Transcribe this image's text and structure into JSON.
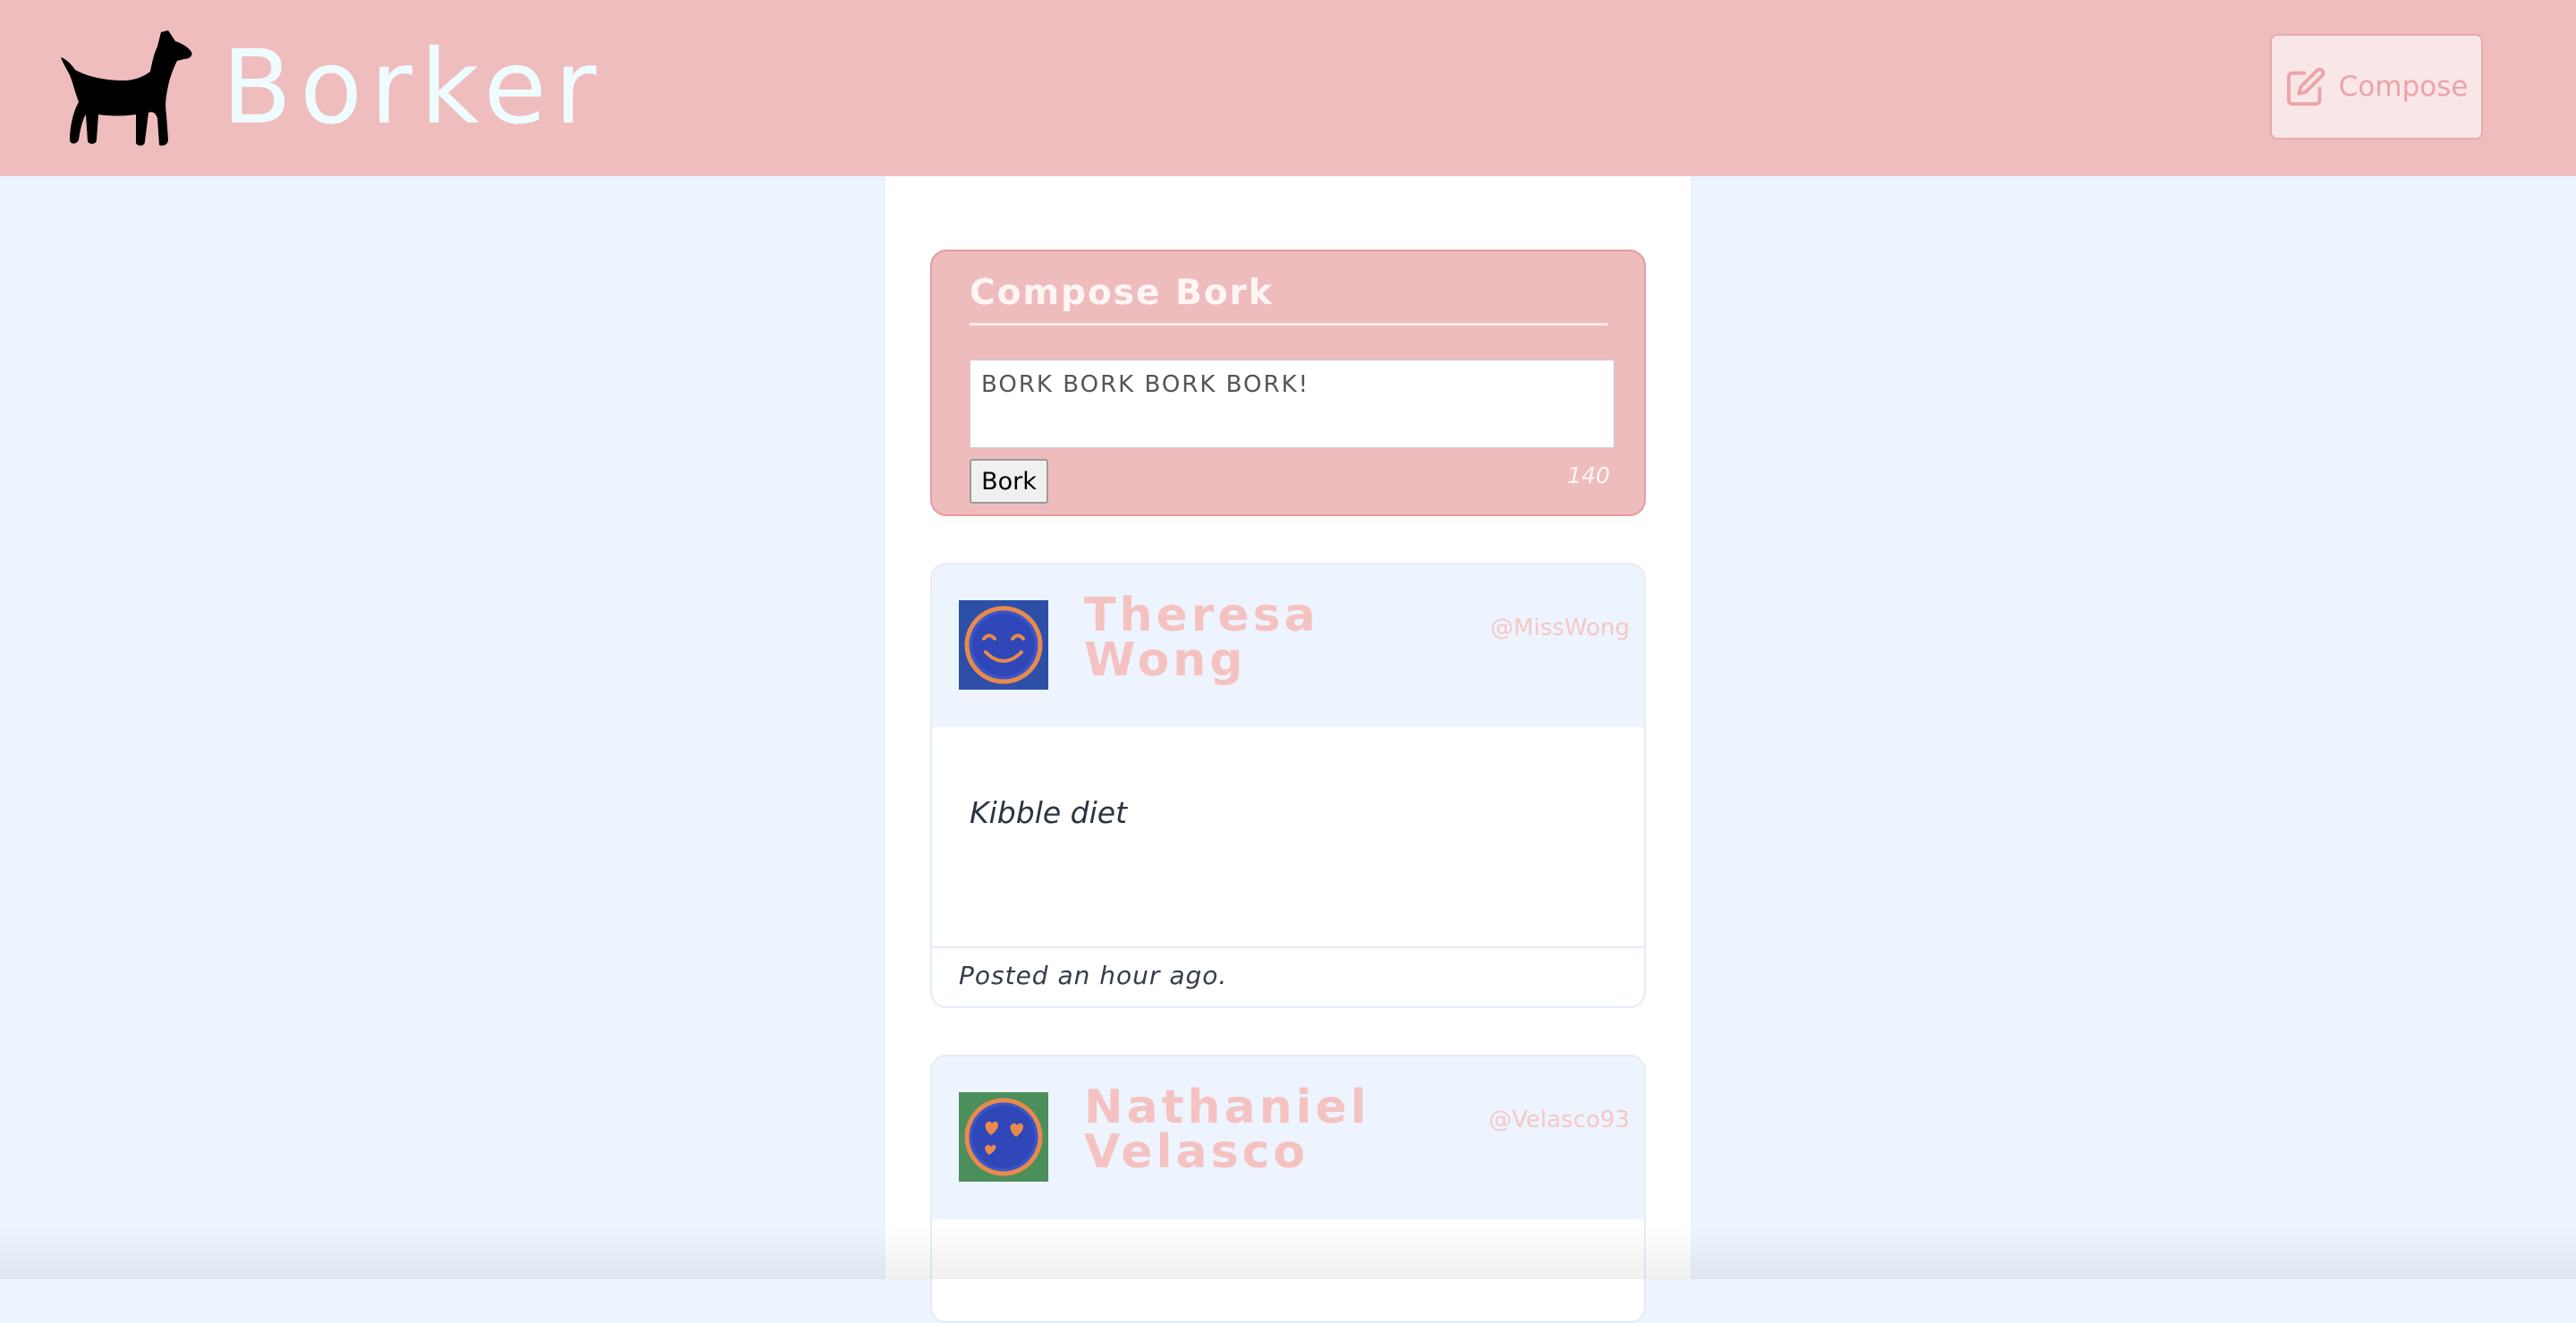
{
  "header": {
    "brand": "Borker",
    "logo_icon": "dog-silhouette-icon",
    "compose_icon": "edit-square-icon",
    "compose_label": "Compose"
  },
  "compose": {
    "title": "Compose Bork",
    "input_value": "BORK BORK BORK BORK!",
    "submit_label": "Bork",
    "char_count": "140"
  },
  "posts": [
    {
      "name": "Theresa Wong",
      "handle": "@MissWong",
      "body": "Kibble diet",
      "time": "Posted an hour ago.",
      "avatar_icon": "smiling-face-avatar-icon",
      "avatar_bg": "#2d4fa8"
    },
    {
      "name": "Nathaniel Velasco",
      "handle": "@Velasco93",
      "avatar_icon": "heart-eyes-face-avatar-icon",
      "avatar_bg": "#4a8f5c"
    }
  ],
  "colors": {
    "header_bg": "#efbdbd",
    "page_bg": "#ecf4fe",
    "accent_pink": "#f5c2c2",
    "compose_bg": "#efbcbd"
  }
}
